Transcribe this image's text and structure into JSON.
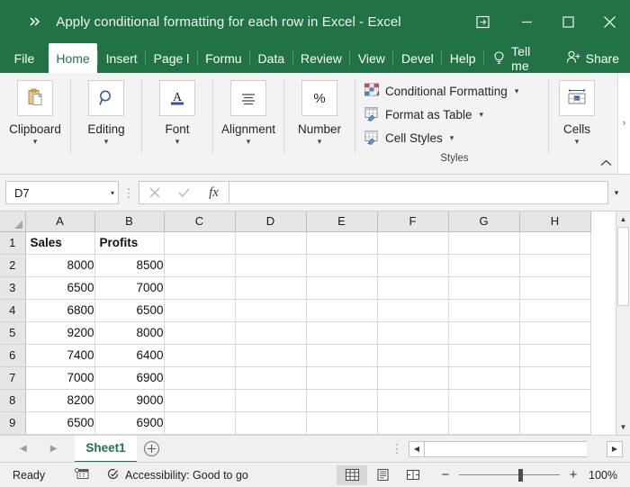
{
  "window": {
    "title": "Apply conditional formatting for each row in Excel  -  Excel",
    "qat_overflow_icon": "double-chevron-right-icon",
    "ribbon_display_options_icon": "ribbon-display-options-icon",
    "minimize_icon": "minimize-icon",
    "maximize_icon": "maximize-icon",
    "close_icon": "close-icon",
    "accent_color": "#217346"
  },
  "tabs": [
    {
      "label": "File",
      "active": false
    },
    {
      "label": "Home",
      "active": true
    },
    {
      "label": "Insert",
      "active": false
    },
    {
      "label": "Page l",
      "active": false
    },
    {
      "label": "Formu",
      "active": false
    },
    {
      "label": "Data",
      "active": false
    },
    {
      "label": "Review",
      "active": false
    },
    {
      "label": "View",
      "active": false
    },
    {
      "label": "Devel",
      "active": false
    },
    {
      "label": "Help",
      "active": false
    }
  ],
  "tellme": {
    "label": "Tell me",
    "icon": "lightbulb-icon"
  },
  "share": {
    "label": "Share",
    "icon": "person-share-icon"
  },
  "ribbon": {
    "collapsed_groups": [
      {
        "label": "Clipboard",
        "icon": "clipboard-icon",
        "chevron": "chevron-down-icon"
      },
      {
        "label": "Editing",
        "icon": "magnifier-icon",
        "chevron": "chevron-down-icon"
      },
      {
        "label": "Font",
        "icon": "font-a-icon",
        "chevron": "chevron-down-icon"
      },
      {
        "label": "Alignment",
        "icon": "align-lines-icon",
        "chevron": "chevron-down-icon"
      },
      {
        "label": "Number",
        "icon": "percent-icon",
        "chevron": "chevron-down-icon"
      }
    ],
    "styles": {
      "group_label": "Styles",
      "items": [
        {
          "label": "Conditional Formatting",
          "icon": "conditional-formatting-icon",
          "chevron": "chevron-down-icon"
        },
        {
          "label": "Format as Table",
          "icon": "format-as-table-icon",
          "chevron": "chevron-down-icon"
        },
        {
          "label": "Cell Styles",
          "icon": "cell-styles-icon",
          "chevron": "chevron-down-icon"
        }
      ]
    },
    "cells": {
      "label": "Cells",
      "icon": "cells-icon",
      "chevron": "chevron-down-icon"
    },
    "scroll_right_icon": "chevron-right-icon",
    "collapse_ribbon_icon": "chevron-up-icon"
  },
  "formula_bar": {
    "name_box_value": "D7",
    "name_box_chevron": "chevron-down-icon",
    "cancel_icon": "x-icon",
    "enter_icon": "check-icon",
    "function_icon": "fx-icon",
    "formula_value": "",
    "expand_icon": "chevron-down-icon"
  },
  "sheet": {
    "columns": [
      "A",
      "B",
      "C",
      "D",
      "E",
      "F",
      "G",
      "H"
    ],
    "rows": [
      {
        "num": "1",
        "cells": [
          "Sales",
          "Profits",
          "",
          "",
          "",
          "",
          "",
          ""
        ],
        "header_row": true
      },
      {
        "num": "2",
        "cells": [
          "8000",
          "8500",
          "",
          "",
          "",
          "",
          "",
          ""
        ],
        "header_row": false
      },
      {
        "num": "3",
        "cells": [
          "6500",
          "7000",
          "",
          "",
          "",
          "",
          "",
          ""
        ],
        "header_row": false
      },
      {
        "num": "4",
        "cells": [
          "6800",
          "6500",
          "",
          "",
          "",
          "",
          "",
          ""
        ],
        "header_row": false
      },
      {
        "num": "5",
        "cells": [
          "9200",
          "8000",
          "",
          "",
          "",
          "",
          "",
          ""
        ],
        "header_row": false
      },
      {
        "num": "6",
        "cells": [
          "7400",
          "6400",
          "",
          "",
          "",
          "",
          "",
          ""
        ],
        "header_row": false
      },
      {
        "num": "7",
        "cells": [
          "7000",
          "6900",
          "",
          "",
          "",
          "",
          "",
          ""
        ],
        "header_row": false
      },
      {
        "num": "8",
        "cells": [
          "8200",
          "9000",
          "",
          "",
          "",
          "",
          "",
          ""
        ],
        "header_row": false
      },
      {
        "num": "9",
        "cells": [
          "6500",
          "6900",
          "",
          "",
          "",
          "",
          "",
          ""
        ],
        "header_row": false
      }
    ],
    "select_all_icon": "select-all-corner-icon",
    "vscroll_up_icon": "triangle-up-icon",
    "vscroll_down_icon": "triangle-down-icon"
  },
  "sheet_tabs": {
    "prev_icon": "triangle-left-icon",
    "next_icon": "triangle-right-icon",
    "tabs": [
      {
        "label": "Sheet1",
        "active": true
      }
    ],
    "add_sheet_icon": "plus-circle-icon",
    "overflow_dots_icon": "vertical-dots-icon",
    "hscroll_left_icon": "triangle-left-icon",
    "hscroll_right_icon": "triangle-right-icon"
  },
  "status_bar": {
    "status": "Ready",
    "macro_record_icon": "record-macro-icon",
    "accessibility_icon": "accessibility-icon",
    "accessibility_text": "Accessibility: Good to go",
    "views": [
      {
        "name": "normal-view",
        "icon": "normal-view-icon",
        "active": true
      },
      {
        "name": "page-layout-view",
        "icon": "page-layout-view-icon",
        "active": false
      },
      {
        "name": "page-break-view",
        "icon": "page-break-view-icon",
        "active": false
      }
    ],
    "zoom_out_label": "−",
    "zoom_in_label": "+",
    "zoom_value": "100%"
  }
}
